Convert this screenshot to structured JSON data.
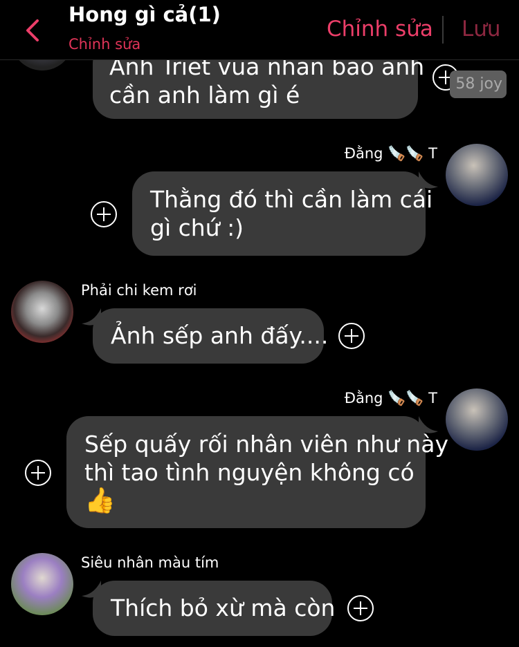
{
  "header": {
    "title": "Hong gì cả(1)",
    "subtitle": "Chỉnh sửa",
    "edit_label": "Chỉnh sửa",
    "save_label": "Lưu",
    "accent_color": "#ec3e69"
  },
  "messages": [
    {
      "sender": "",
      "side": "left",
      "lines": [
        "Anh Triet vua nhan bao anh",
        "cần anh làm gì é"
      ],
      "time": "58 joy"
    },
    {
      "sender": "Đằng 🪚🪚 T",
      "side": "right",
      "lines": [
        "Thằng đó thì cần làm cái",
        "gì chứ :)"
      ]
    },
    {
      "sender": "Phải chi kem rơi",
      "side": "left",
      "lines": [
        "Ảnh sếp anh đấy...."
      ]
    },
    {
      "sender": "Đằng 🪚🪚 T",
      "side": "right",
      "lines": [
        "Sếp quấy rối nhân viên như này",
        "thì tao tình nguyện không có",
        "👍"
      ]
    },
    {
      "sender": "Siêu nhân màu tím",
      "side": "left",
      "lines": [
        "Thích bỏ xừ mà còn"
      ]
    }
  ],
  "icons": {
    "back": "chevron-left-icon",
    "react": "plus-circle-icon"
  }
}
